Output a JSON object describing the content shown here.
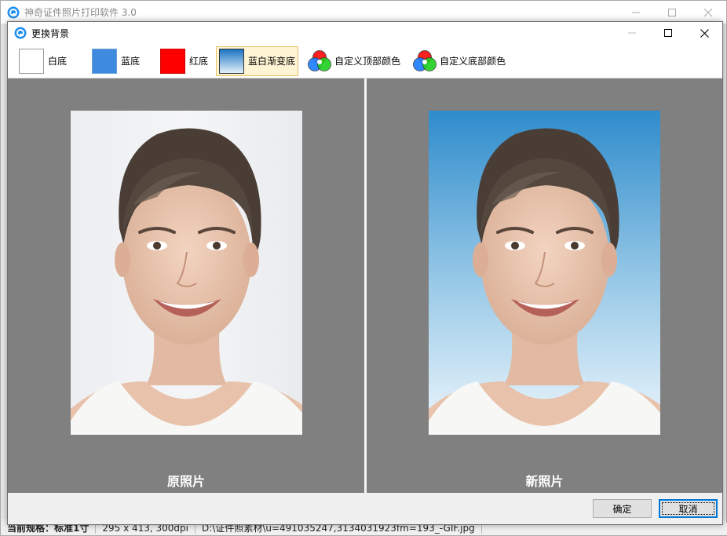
{
  "app": {
    "title": "神奇证件照片打印软件 3.0"
  },
  "background_status": {
    "spec_label": "当前规格：标准1寸",
    "size_info": "295 x 413, 300dpi",
    "file_path": "D:\\证件照素材\\u=491035247,3134031923fm=193_-GIF.jpg"
  },
  "dialog": {
    "title": "更换背景",
    "toolbar": {
      "options": [
        {
          "label": "白底",
          "swatch": "#ffffff"
        },
        {
          "label": "蓝底",
          "swatch": "#3d8adf"
        },
        {
          "label": "红底",
          "swatch": "#ff0000"
        },
        {
          "label": "蓝白渐变底",
          "swatch": "gradient",
          "selected": true
        },
        {
          "label": "自定义顶部颜色",
          "icon": "rgb-color-icon"
        },
        {
          "label": "自定义底部颜色",
          "icon": "rgb-color-icon"
        }
      ]
    },
    "panels": {
      "original_caption": "原照片",
      "new_caption": "新照片"
    },
    "buttons": {
      "ok": "确定",
      "cancel": "取消"
    }
  },
  "colors": {
    "panel_bg": "#808080",
    "selected_bg": "#fff4d4",
    "accent": "#0078d7"
  }
}
